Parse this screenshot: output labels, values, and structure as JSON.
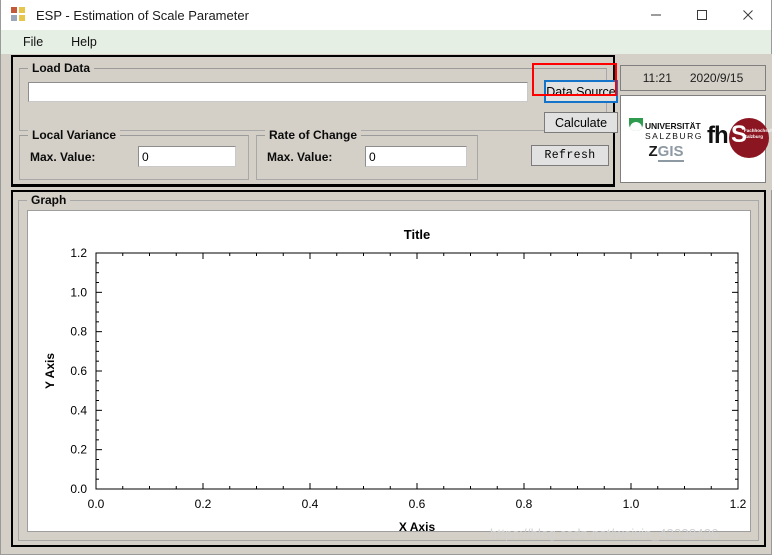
{
  "window": {
    "title": "ESP - Estimation of Scale Parameter",
    "icon": "app-grid-icon",
    "controls": {
      "minimize": "minimize-icon",
      "maximize": "maximize-icon",
      "close": "close-icon"
    }
  },
  "menu": {
    "items": [
      {
        "label": "File"
      },
      {
        "label": "Help"
      }
    ]
  },
  "load_data": {
    "group_title": "Load Data",
    "path_value": "",
    "path_placeholder": "",
    "data_source_label": "Data Source",
    "calculate_label": "Calculate",
    "focus_highlight_color": "#ff0000",
    "focus_border_color": "#1373c8"
  },
  "local_variance": {
    "group_title": "Local Variance",
    "max_value_label": "Max. Value:",
    "max_value": "0"
  },
  "rate_of_change": {
    "group_title": "Rate of Change",
    "max_value_label": "Max. Value:",
    "max_value": "0"
  },
  "refresh": {
    "label": "Refresh"
  },
  "status": {
    "time": "11:21",
    "date": "2020/9/15"
  },
  "logos": {
    "university": {
      "line1": "UNIVERSITÄT",
      "line2": "SALZBURG",
      "mark_color": "#2e9b4f",
      "z": "Z",
      "gis": "GIS"
    },
    "fhs": {
      "fh": "fh",
      "s": "S",
      "subtitle_line1": "Fachhochschule",
      "subtitle_line2": "Salzburg",
      "circle_color": "#8b1520"
    }
  },
  "graph": {
    "group_title": "Graph"
  },
  "watermark": {
    "text": "https://blog.csdn.net/weixin_43238426"
  },
  "chart_data": {
    "type": "line",
    "title": "Title",
    "xlabel": "X Axis",
    "ylabel": "Y Axis",
    "xlim": [
      0.0,
      1.2
    ],
    "ylim": [
      0.0,
      1.2
    ],
    "xticks": [
      0.0,
      0.2,
      0.4,
      0.6,
      0.8,
      1.0,
      1.2
    ],
    "yticks": [
      0.0,
      0.2,
      0.4,
      0.6,
      0.8,
      1.0,
      1.2
    ],
    "xtick_labels": [
      "0.0",
      "0.2",
      "0.4",
      "0.6",
      "0.8",
      "1.0",
      "1.2"
    ],
    "ytick_labels": [
      "0.0",
      "0.2",
      "0.4",
      "0.6",
      "0.8",
      "1.0",
      "1.2"
    ],
    "minor_tick_step": 0.05,
    "grid": false,
    "legend": null,
    "series": [
      {
        "name": "",
        "x": [],
        "y": []
      }
    ]
  }
}
